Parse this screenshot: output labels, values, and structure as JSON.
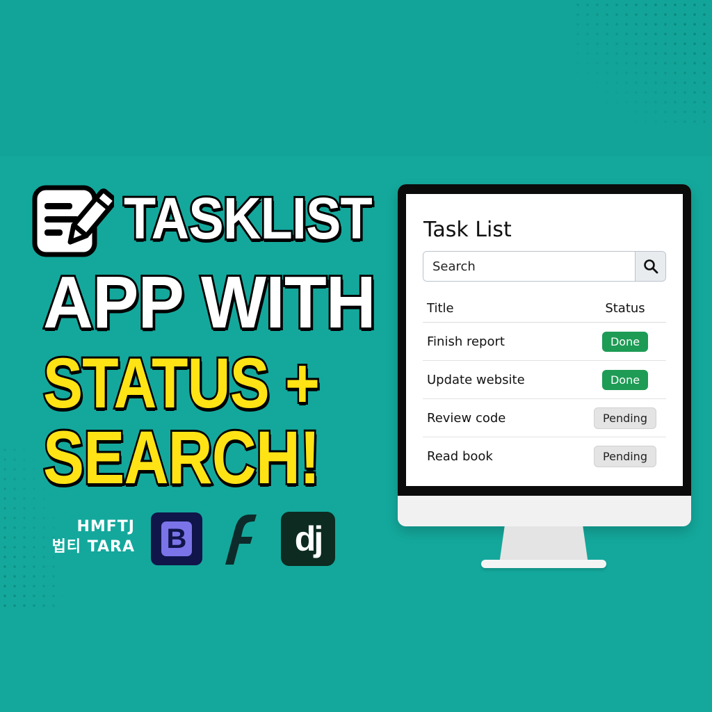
{
  "headline": {
    "line1": "TASKLIST",
    "line2": "APP WITH",
    "line3": "STATUS +",
    "line4": "SEARCH!"
  },
  "credit": {
    "line1": "HMFTJ",
    "line2": "법티 TARA"
  },
  "logos": {
    "bootstrap_letter": "B",
    "django_text": "dj",
    "icons": [
      "notepad-pencil-icon",
      "bootstrap-logo",
      "flutter-logo",
      "django-logo"
    ]
  },
  "app": {
    "title": "Task List",
    "search": {
      "placeholder": "Search",
      "button_icon": "search-icon"
    },
    "table": {
      "headers": {
        "title": "Title",
        "status": "Status"
      },
      "rows": [
        {
          "title": "Finish report",
          "status": "Done"
        },
        {
          "title": "Update website",
          "status": "Done"
        },
        {
          "title": "Review code",
          "status": "Pending"
        },
        {
          "title": "Read book",
          "status": "Pending"
        }
      ]
    }
  },
  "colors": {
    "background": "#14a89c",
    "headline_yellow": "#ffe315",
    "done_green": "#1e9b55",
    "pending_gray": "#e4e4e4"
  }
}
